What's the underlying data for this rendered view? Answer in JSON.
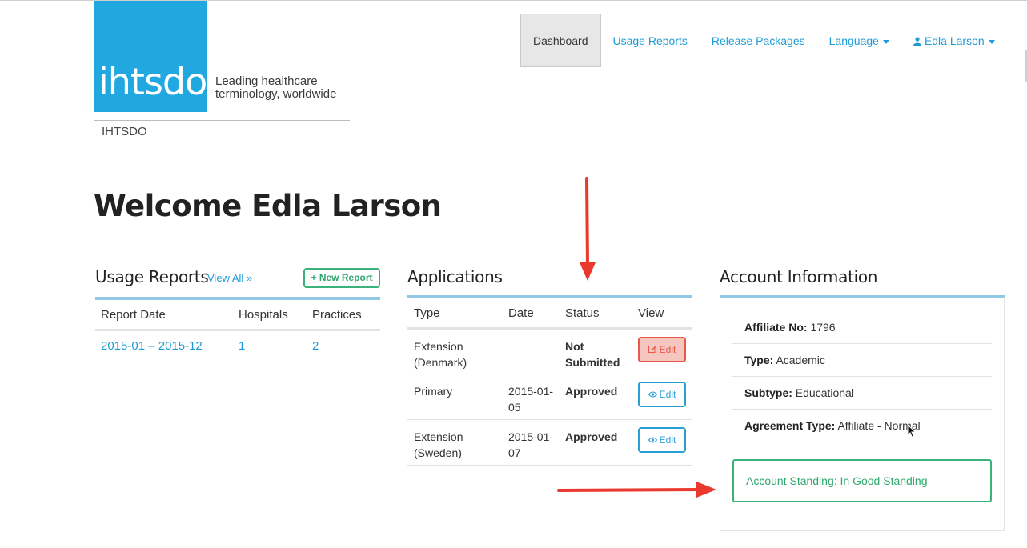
{
  "brand": {
    "logo_text": "ihtsdo",
    "tagline_line1": "Leading healthcare",
    "tagline_line2": "terminology, worldwide",
    "org_name": "IHTSDO",
    "logo_color": "#21a8e1"
  },
  "nav": {
    "items": [
      {
        "label": "Dashboard",
        "active": true
      },
      {
        "label": "Usage Reports",
        "active": false
      },
      {
        "label": "Release Packages",
        "active": false
      },
      {
        "label": "Language",
        "active": false,
        "dropdown": true
      },
      {
        "label": "Edla Larson",
        "active": false,
        "dropdown": true,
        "icon": "user-icon"
      }
    ]
  },
  "welcome": "Welcome Edla Larson",
  "usage_reports": {
    "title": "Usage Reports",
    "view_all": "View All »",
    "new_report": "+ New Report",
    "columns": [
      "Report Date",
      "Hospitals",
      "Practices"
    ],
    "rows": [
      {
        "date": "2015-01 – 2015-12",
        "hospitals": "1",
        "practices": "2"
      }
    ]
  },
  "applications": {
    "title": "Applications",
    "columns": [
      "Type",
      "Date",
      "Status",
      "View"
    ],
    "rows": [
      {
        "type": "Extension (Denmark)",
        "date": "",
        "status": "Not Submitted",
        "status_kind": "not-submitted",
        "action": "Edit",
        "action_icon": "edit-icon"
      },
      {
        "type": "Primary",
        "date": "2015-01-05",
        "status": "Approved",
        "status_kind": "approved",
        "action": "Edit",
        "action_icon": "eye-icon"
      },
      {
        "type": "Extension (Sweden)",
        "date": "2015-01-07",
        "status": "Approved",
        "status_kind": "approved",
        "action": "Edit",
        "action_icon": "eye-icon"
      }
    ]
  },
  "account": {
    "title": "Account Information",
    "fields": [
      {
        "label": "Affiliate No:",
        "value": "1796"
      },
      {
        "label": "Type:",
        "value": "Academic"
      },
      {
        "label": "Subtype:",
        "value": "Educational"
      },
      {
        "label": "Agreement Type:",
        "value": "Affiliate - Normal"
      }
    ],
    "standing_label": "Account Standing:",
    "standing_value": "In Good Standing"
  },
  "colors": {
    "link": "#1e9bd7",
    "success": "#3bb27a",
    "danger": "#e8594a",
    "annotation_arrow": "#e8392c"
  }
}
